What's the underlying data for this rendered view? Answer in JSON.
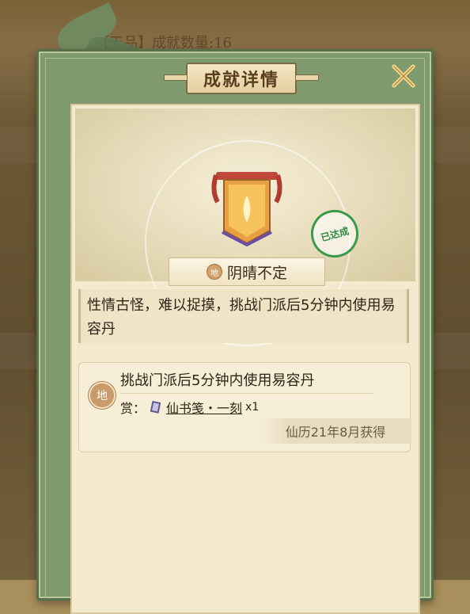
{
  "background": {
    "title": "【天品】成就数量:16"
  },
  "dialog": {
    "title": "成就详情",
    "close_icon": "close-icon"
  },
  "achievement": {
    "grade_icon": "地",
    "name": "阴晴不定",
    "status_stamp": "已达成",
    "description": "性情古怪，难以捉摸，挑战门派后5分钟内使用易容丹"
  },
  "task": {
    "grade_icon": "地",
    "title": "挑战门派后5分钟内使用易容丹",
    "reward_label": "赏：",
    "reward_item": "仙书笺・一刻",
    "reward_qty": "x1",
    "obtained_date": "仙历21年8月获得"
  },
  "colors": {
    "panel_green": "#7f9b6e",
    "parchment": "#f3ead0",
    "title_brown": "#5a3d1e",
    "stamp_green": "#2f8a3e"
  }
}
